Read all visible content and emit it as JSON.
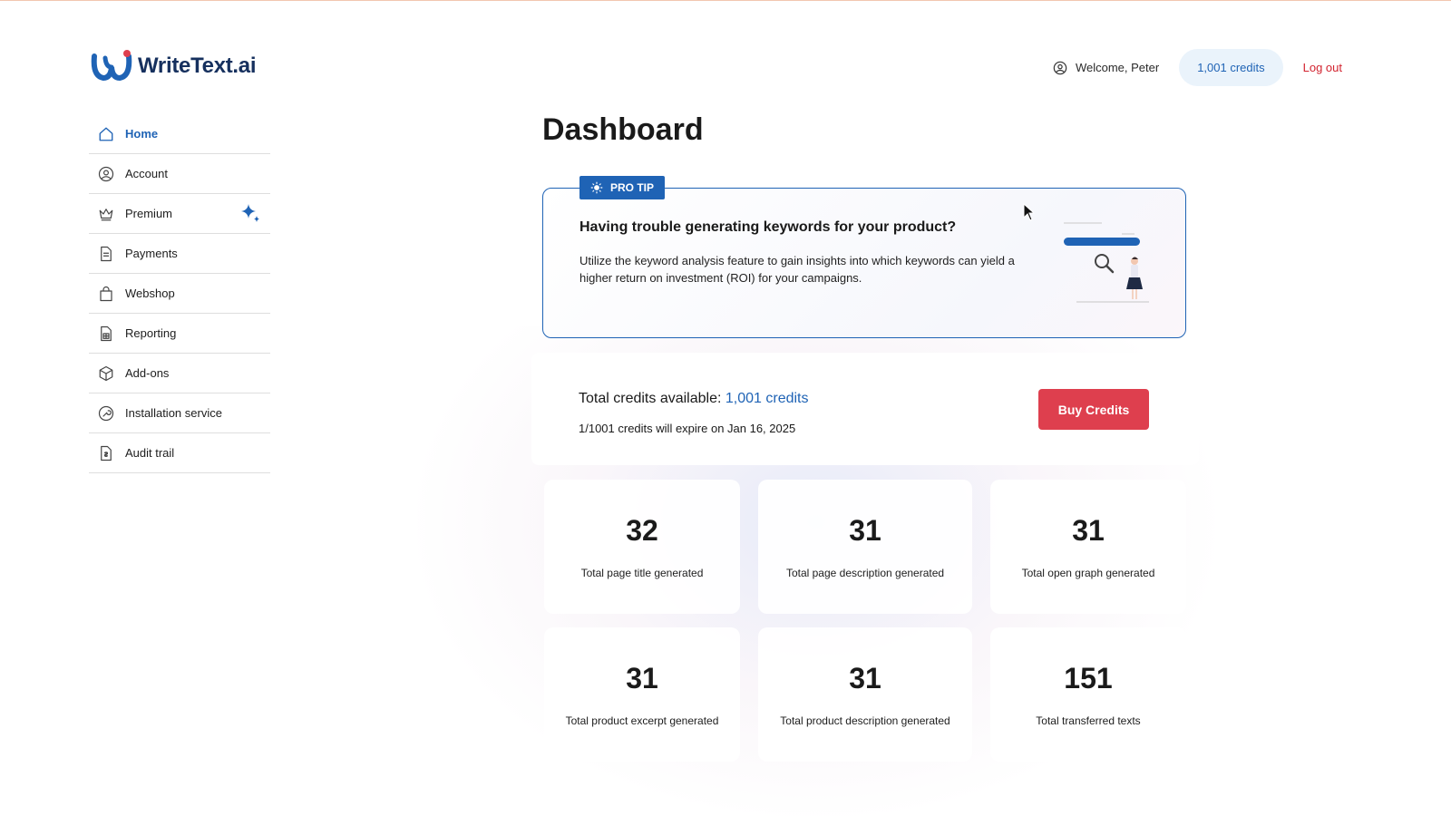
{
  "app": {
    "logo_text": "WriteText.ai",
    "brand_color": "#1f63b5",
    "alert_color": "#de3f4e"
  },
  "header": {
    "welcome": "Welcome, Peter",
    "credits": "1,001 credits",
    "logout": "Log out",
    "user_icon": "user-circle-icon"
  },
  "sidebar": {
    "items": [
      {
        "label": "Home",
        "icon": "home-icon",
        "active": true
      },
      {
        "label": "Account",
        "icon": "user-circle-icon"
      },
      {
        "label": "Premium",
        "icon": "crown-icon"
      },
      {
        "label": "Payments",
        "icon": "document-icon"
      },
      {
        "label": "Webshop",
        "icon": "shopping-bag-icon"
      },
      {
        "label": "Reporting",
        "icon": "report-icon"
      },
      {
        "label": "Add-ons",
        "icon": "box-icon"
      },
      {
        "label": "Installation service",
        "icon": "wrench-icon"
      },
      {
        "label": "Audit trail",
        "icon": "audit-icon"
      }
    ]
  },
  "main": {
    "title": "Dashboard",
    "tip": {
      "badge": "PRO TIP",
      "heading": "Having trouble generating keywords for your product?",
      "body": "Utilize the keyword analysis feature to gain insights into which keywords can yield a higher return on investment (ROI) for your campaigns."
    },
    "credits": {
      "label": "Total credits available:",
      "value": "1,001 credits",
      "expire": "1/1001 credits will expire on Jan 16, 2025",
      "buy_button": "Buy Credits"
    },
    "stats": [
      {
        "value": "32",
        "label": "Total page title generated"
      },
      {
        "value": "31",
        "label": "Total page description generated"
      },
      {
        "value": "31",
        "label": "Total open graph generated"
      },
      {
        "value": "31",
        "label": "Total product excerpt generated"
      },
      {
        "value": "31",
        "label": "Total product description generated"
      },
      {
        "value": "151",
        "label": "Total transferred texts"
      }
    ]
  }
}
